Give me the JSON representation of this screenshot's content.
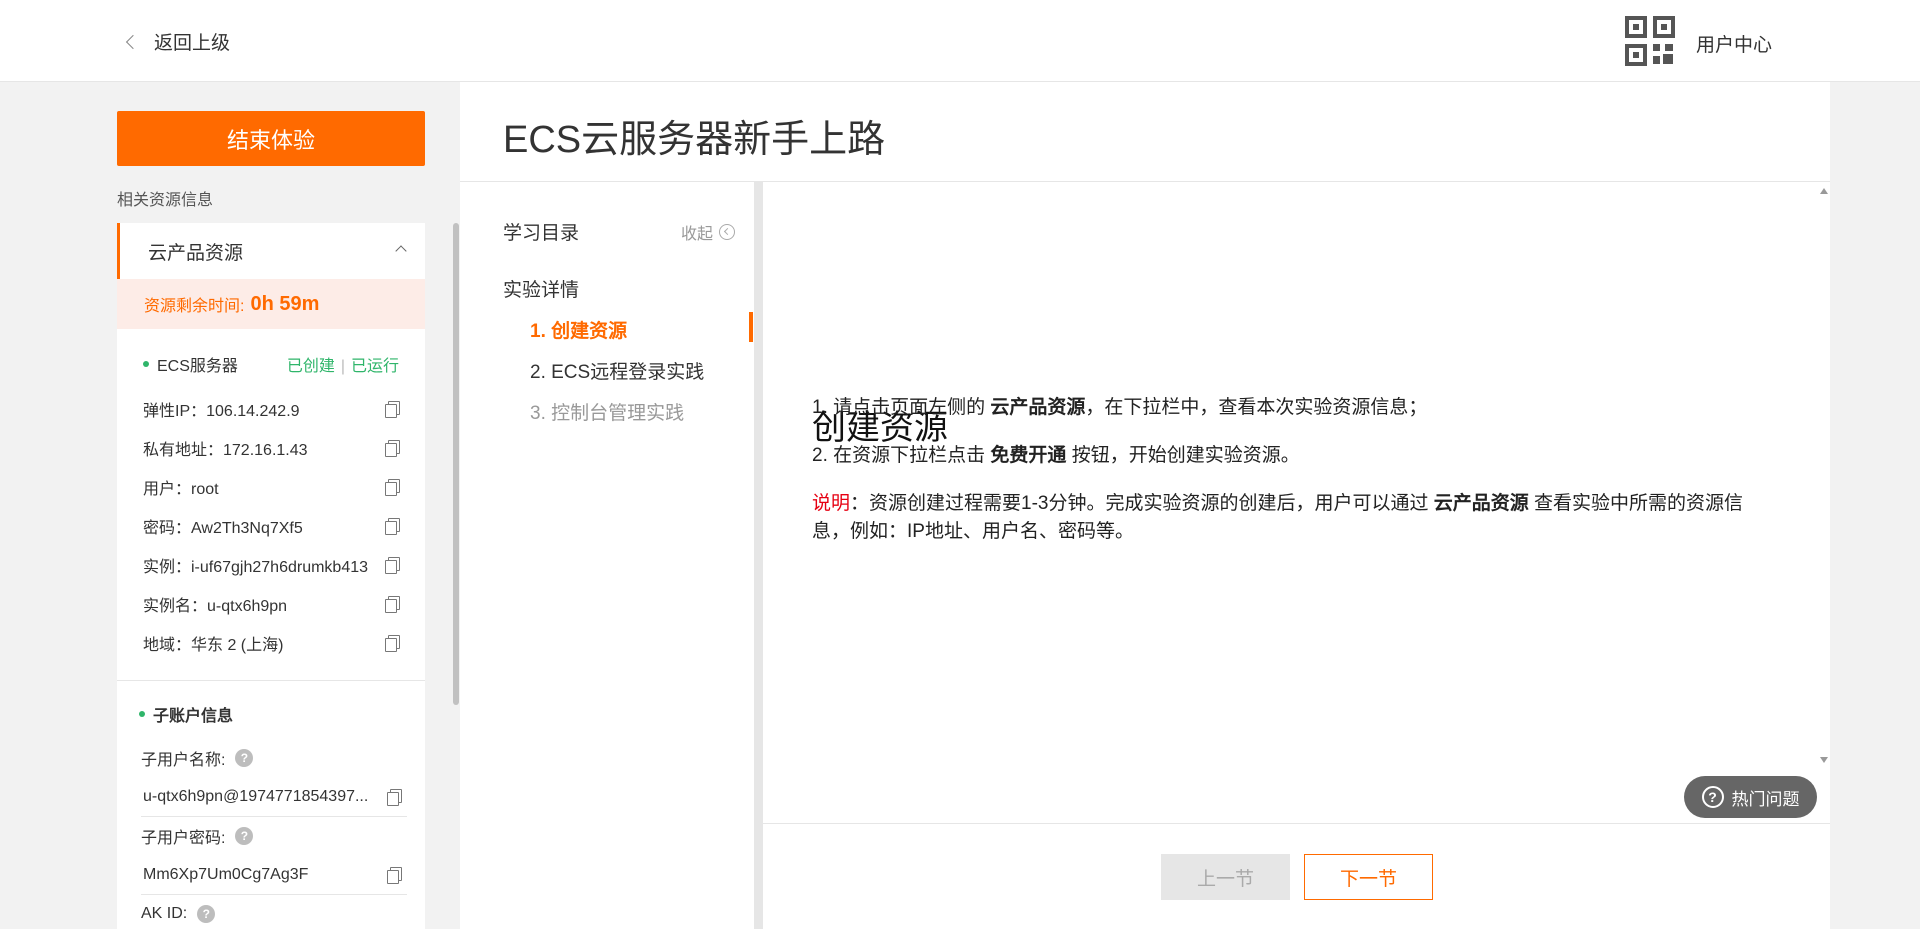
{
  "header": {
    "back_label": "返回上级",
    "user_center": "用户中心"
  },
  "left": {
    "end_button": "结束体验",
    "resource_info_label": "相关资源信息",
    "cloud_product_title": "云产品资源",
    "timer_label": "资源剩余时间:",
    "timer_value": "0h 59m",
    "ecs_name": "ECS服务器",
    "ecs_status_created": "已创建",
    "ecs_status_running": "已运行",
    "ecs_status_sep": "|",
    "items": [
      {
        "text": "弹性IP：106.14.242.9"
      },
      {
        "text": "私有地址：172.16.1.43"
      },
      {
        "text": "用户：root"
      },
      {
        "text": "密码：Aw2Th3Nq7Xf5"
      },
      {
        "text": "实例：i-uf67gjh27h6drumkb413"
      },
      {
        "text": "实例名：u-qtx6h9pn"
      },
      {
        "text": "地域：华东 2 (上海)"
      }
    ],
    "sub_account_title": "子账户信息",
    "sub_user_name_label": "子用户名称:",
    "sub_user_name_value": "u-qtx6h9pn@1974771854397...",
    "sub_user_pwd_label": "子用户密码:",
    "sub_user_pwd_value": "Mm6Xp7Um0Cg7Ag3F",
    "ak_id_label": "AK ID:",
    "help_glyph": "?"
  },
  "main": {
    "title": "ECS云服务器新手上路",
    "toc_title": "学习目录",
    "collapse_label": "收起",
    "toc_section": "实验详情",
    "toc_items": [
      {
        "label": "1. 创建资源",
        "state": "active"
      },
      {
        "label": "2. ECS远程登录实践",
        "state": "normal"
      },
      {
        "label": "3. 控制台管理实践",
        "state": "disabled"
      }
    ],
    "content_title": "创建资源",
    "step1_prefix": "1.  请点击页面左侧的 ",
    "step1_bold": "云产品资源",
    "step1_suffix": "，在下拉栏中，查看本次实验资源信息；",
    "step2_prefix": "2.  在资源下拉栏点击 ",
    "step2_bold": "免费开通",
    "step2_suffix": " 按钮，开始创建实验资源。",
    "note_label": "说明",
    "note_prefix": "：资源创建过程需要1-3分钟。完成实验资源的创建后，用户可以通过 ",
    "note_bold": "云产品资源",
    "note_suffix": " 查看实验中所需的资源信息，例如：IP地址、用户名、密码等。",
    "prev_button": "上一节",
    "next_button": "下一节",
    "hot_questions": "热门问题",
    "hot_icon_glyph": "?"
  },
  "colors": {
    "accent": "#ff6a00",
    "status_green": "#2fb56a",
    "note_red": "#e60012"
  }
}
